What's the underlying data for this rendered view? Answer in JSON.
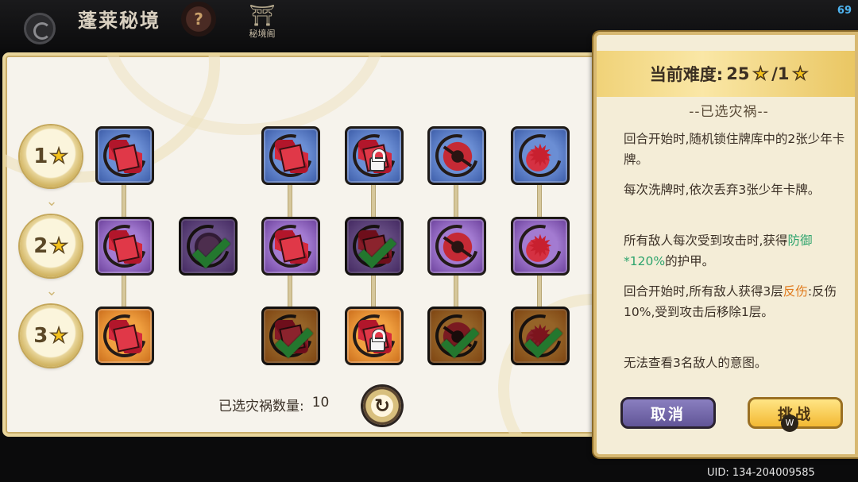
{
  "header": {
    "title": "蓬莱秘境",
    "help_icon": "?",
    "tower_label": "秘境阁",
    "fps": "69"
  },
  "footer": {
    "uid": "UID: 134-204009585"
  },
  "grid": {
    "tiers": [
      {
        "num": "1",
        "star": "★"
      },
      {
        "num": "2",
        "star": "★"
      },
      {
        "num": "3",
        "star": "★"
      }
    ],
    "selected_count_label": "已选灾祸数量:",
    "selected_count": "10",
    "reset_symbol": "↻"
  },
  "side": {
    "difficulty_label": "当前难度:",
    "difficulty_value": "25",
    "difficulty_sep": "/1",
    "star": "★",
    "subtitle": "--已选灾祸--",
    "effects": [
      "回合开始时,随机锁住牌库中的2张少年卡牌。",
      "每次洗牌时,依次丢弃3张少年卡牌。",
      "所有敌人每次受到攻击时,获得",
      "防御*120%",
      "的护甲。",
      "回合开始时,所有敌人获得3层",
      "反伤",
      ":反伤10%,受到攻击后移除1层。",
      "无法查看3名敌人的意图。"
    ],
    "cancel_label": "取消",
    "challenge_label": "挑战",
    "cursor_label": "W"
  },
  "colors": {
    "accent_gold": "#e9c560",
    "highlight_green": "#2ea46d",
    "highlight_orange": "#e07a1c",
    "cancel_purple": "#615597"
  }
}
